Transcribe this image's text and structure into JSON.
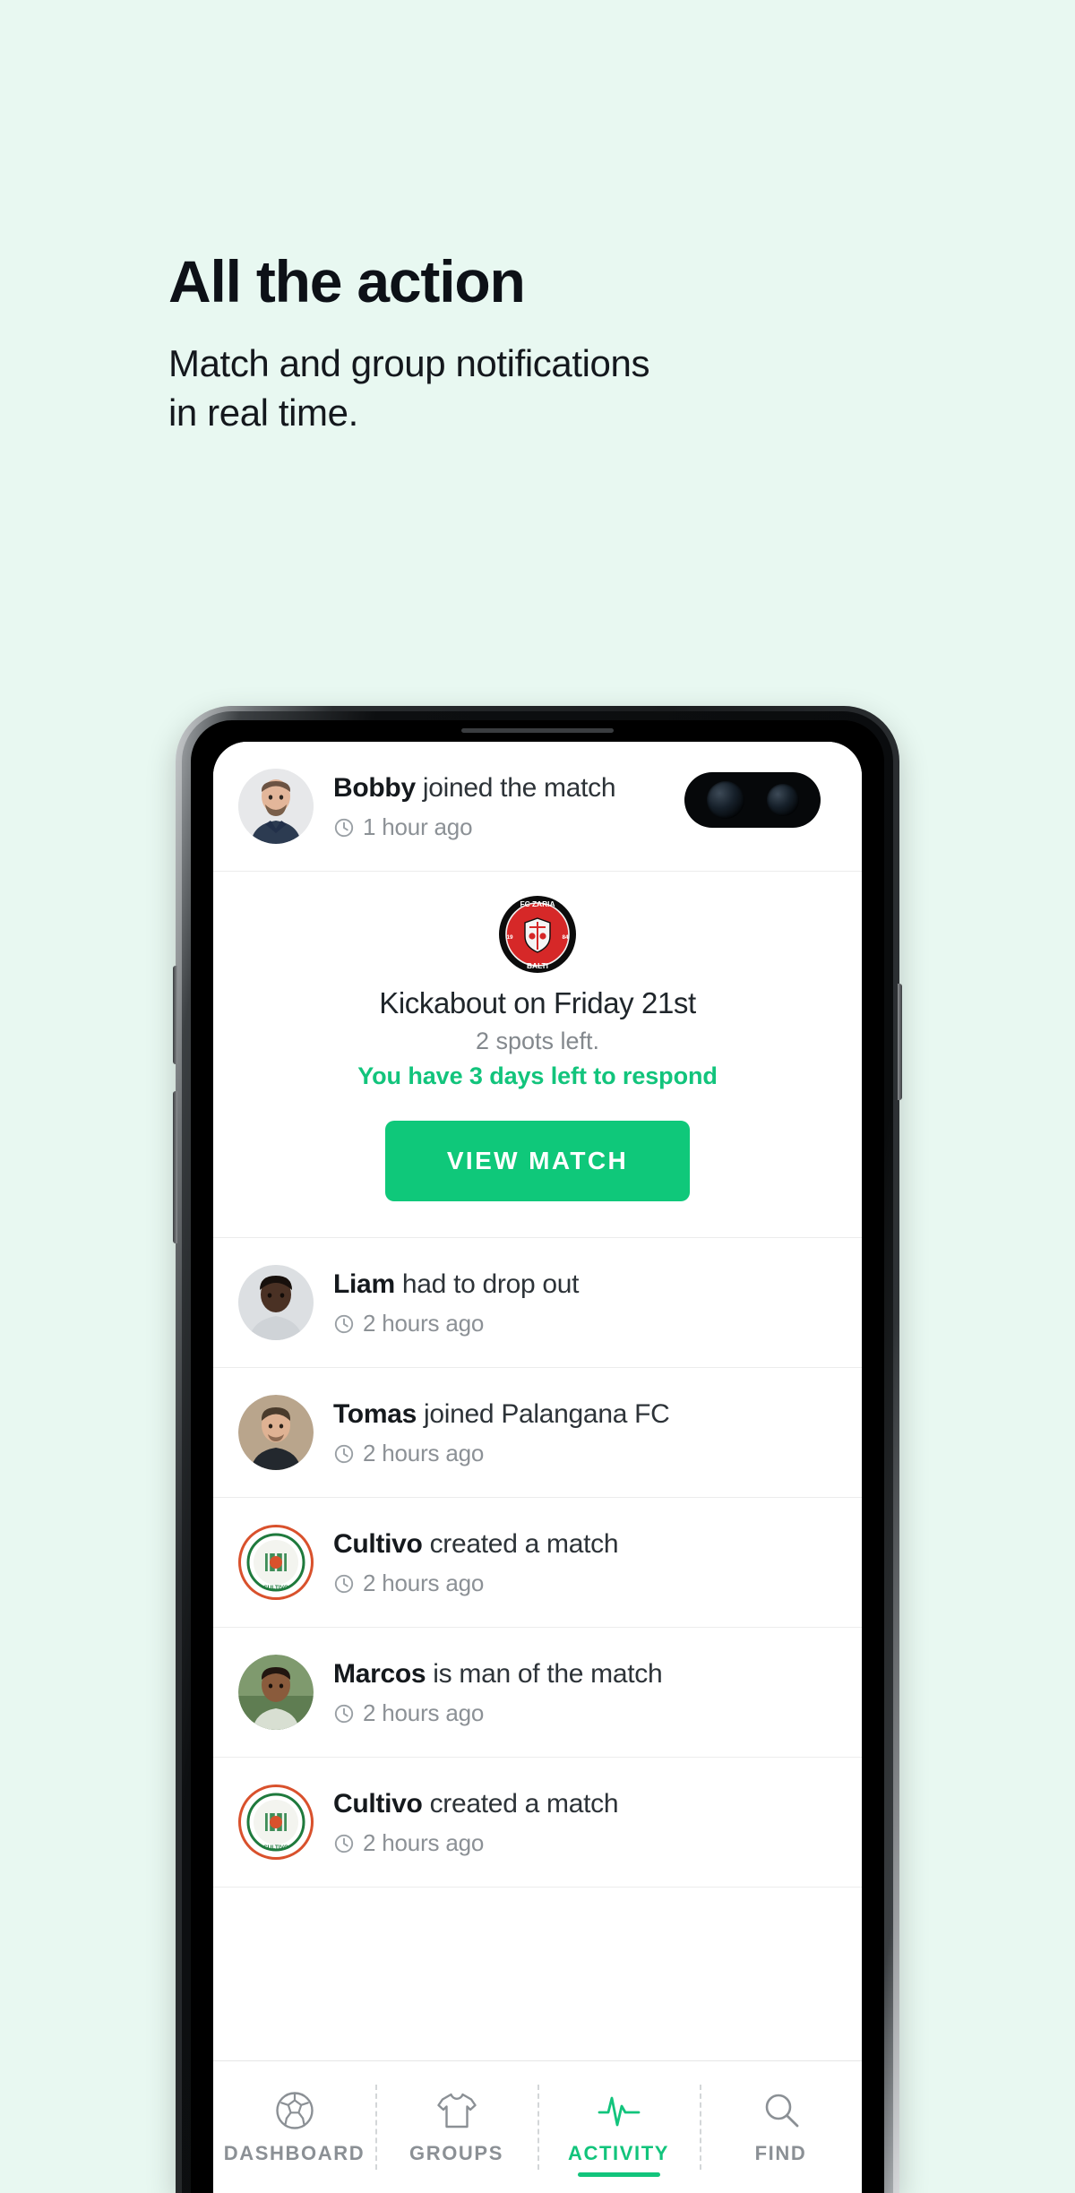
{
  "page": {
    "background_color": "#e8f8f1",
    "accent_color": "#0fc87a",
    "accent_text_color": "#12c47c",
    "muted_text_color": "#8c9196"
  },
  "hero": {
    "title": "All the action",
    "subtitle_line1": "Match and group notifications",
    "subtitle_line2": "in real time."
  },
  "phone": {
    "camera": {
      "lens_primary": "camera-lens-primary",
      "lens_secondary": "camera-lens-secondary"
    }
  },
  "feed": {
    "items": [
      {
        "id": "bobby-joined",
        "actor": "Bobby",
        "action": "joined the match",
        "time": "1 hour ago",
        "avatar_type": "photo-person",
        "avatar_name": "avatar-bobby"
      },
      {
        "id": "liam-dropout",
        "actor": "Liam",
        "action": "had to drop out",
        "time": "2 hours ago",
        "avatar_type": "photo-person",
        "avatar_name": "avatar-liam"
      },
      {
        "id": "tomas-joined-group",
        "actor": "Tomas",
        "action": "joined Palangana FC",
        "time": "2 hours ago",
        "avatar_type": "photo-person",
        "avatar_name": "avatar-tomas"
      },
      {
        "id": "cultivo-created-1",
        "actor": "Cultivo",
        "action": "created a match",
        "time": "2 hours ago",
        "avatar_type": "club-crest",
        "avatar_name": "avatar-cultivo-crest"
      },
      {
        "id": "marcos-motm",
        "actor": "Marcos",
        "action": "is man of the match",
        "time": "2 hours ago",
        "avatar_type": "photo-person",
        "avatar_name": "avatar-marcos"
      },
      {
        "id": "cultivo-created-2",
        "actor": "Cultivo",
        "action": "created a match",
        "time": "2 hours ago",
        "avatar_type": "club-crest",
        "avatar_name": "avatar-cultivo-crest"
      }
    ],
    "match_card": {
      "crest_name": "fc-zaria-balti-crest",
      "crest_top_text": "FC ZARIA",
      "crest_bottom_text": "BALTI",
      "crest_year_left": "19",
      "crest_year_right": "84",
      "title": "Kickabout on Friday 21st",
      "spots": "2 spots left.",
      "respond": "You have 3 days left to respond",
      "button_label": "VIEW MATCH"
    }
  },
  "tabbar": {
    "tabs": [
      {
        "id": "dashboard",
        "label": "DASHBOARD",
        "icon": "football-icon",
        "active": false
      },
      {
        "id": "groups",
        "label": "GROUPS",
        "icon": "tshirt-icon",
        "active": false
      },
      {
        "id": "activity",
        "label": "ACTIVITY",
        "icon": "pulse-icon",
        "active": true
      },
      {
        "id": "find",
        "label": "FIND",
        "icon": "search-icon",
        "active": false
      }
    ]
  }
}
